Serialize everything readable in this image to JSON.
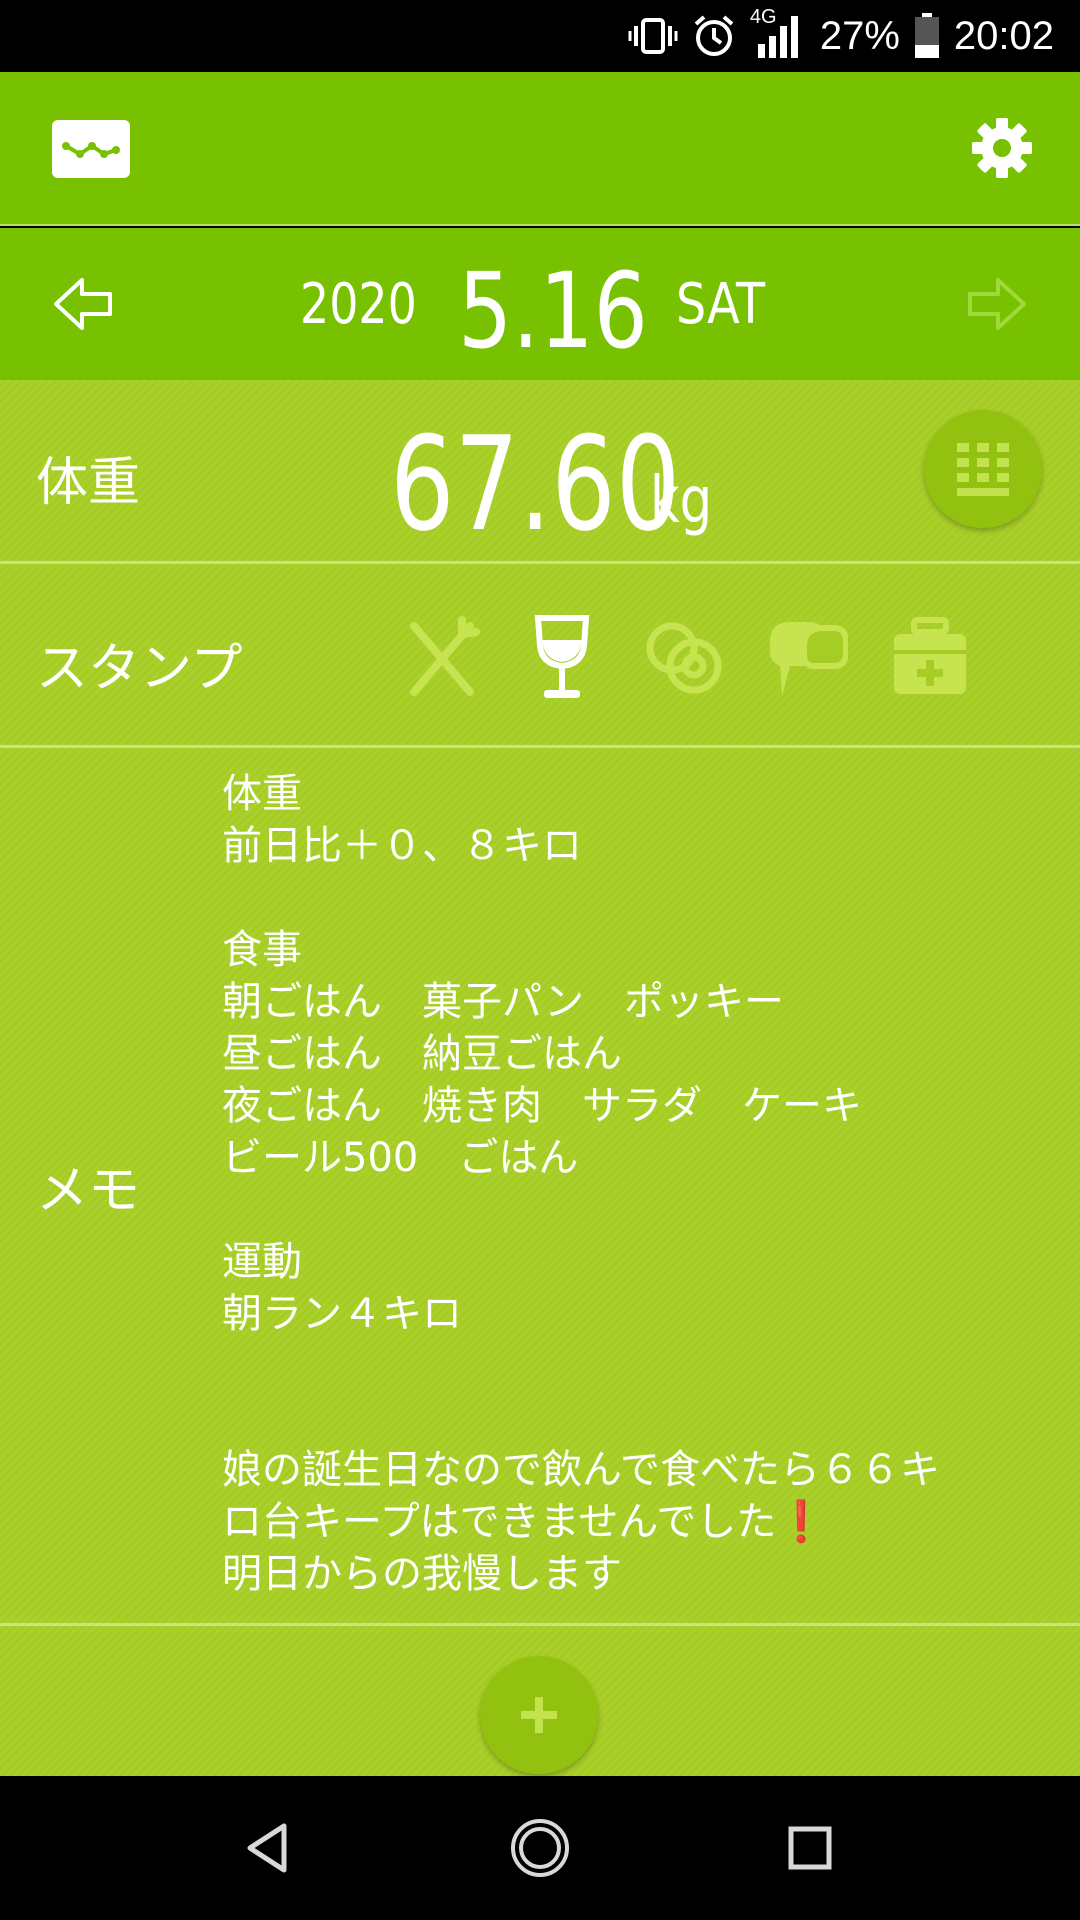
{
  "status_bar": {
    "network": "4G",
    "battery": "27%",
    "time": "20:02"
  },
  "date_nav": {
    "year": "2020",
    "month_day": "5.16",
    "weekday": "SAT"
  },
  "weight": {
    "label": "体重",
    "value": "67.60",
    "unit": "kg"
  },
  "stamps": {
    "label": "スタンプ",
    "items": [
      "meal-icon",
      "wine-glass-icon",
      "coins-icon",
      "chat-icon",
      "medicine-box-icon"
    ]
  },
  "memo": {
    "label": "メモ",
    "text": "体重\n前日比＋０、８キロ\n\n食事\n朝ごはん　菓子パン　ポッキー\n昼ごはん　納豆ごはん\n夜ごはん　焼き肉　サラダ　ケーキ\nビール500　ごはん\n\n運動\n朝ラン４キロ\n\n\n娘の誕生日なので飲んで食べたら６６キ\nロ台キープはできませんでした",
    "exclaim": "❗",
    "text_end": "\n明日からの我慢します"
  },
  "colors": {
    "header": "#77c100",
    "content": "#a6cd24",
    "button": "#93c10f"
  }
}
